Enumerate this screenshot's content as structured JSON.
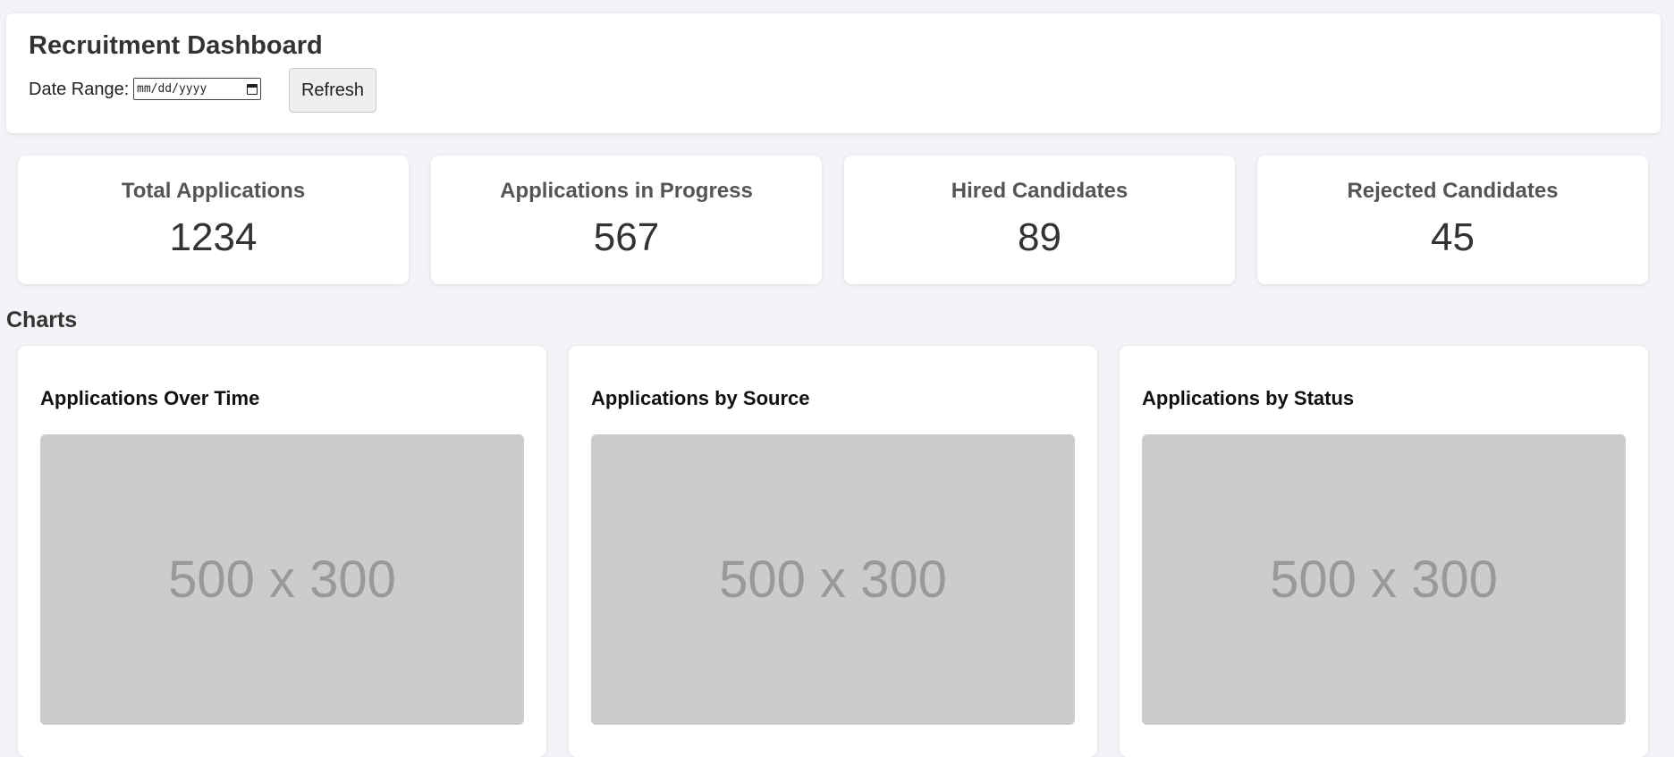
{
  "header": {
    "title": "Recruitment Dashboard",
    "date_range_label": "Date Range:",
    "date_input_placeholder": "mm/dd/yyyy",
    "refresh_label": "Refresh"
  },
  "metrics": [
    {
      "label": "Total Applications",
      "value": "1234"
    },
    {
      "label": "Applications in Progress",
      "value": "567"
    },
    {
      "label": "Hired Candidates",
      "value": "89"
    },
    {
      "label": "Rejected Candidates",
      "value": "45"
    }
  ],
  "charts_section": {
    "heading": "Charts",
    "items": [
      {
        "title": "Applications Over Time",
        "placeholder_text": "500 x 300"
      },
      {
        "title": "Applications by Source",
        "placeholder_text": "500 x 300"
      },
      {
        "title": "Applications by Status",
        "placeholder_text": "500 x 300"
      }
    ]
  },
  "colors": {
    "page_background": "#f4f4f8",
    "card_background": "#ffffff",
    "placeholder_background": "#cccccc",
    "placeholder_text": "#999999",
    "button_background": "#efefef"
  },
  "icons": {
    "date_input": "calendar-icon"
  }
}
